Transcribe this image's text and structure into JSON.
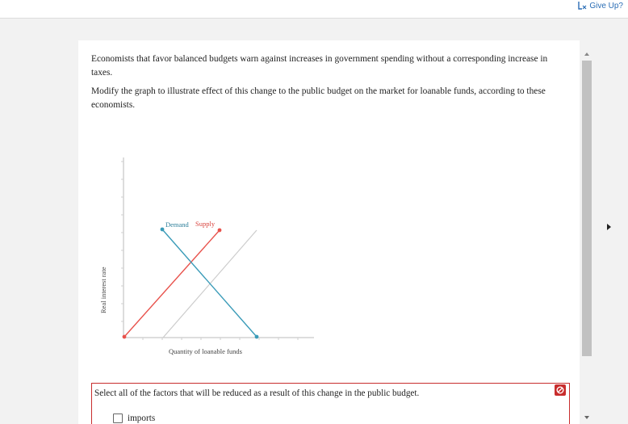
{
  "header": {
    "give_up_label": "Give Up?",
    "give_up_icon": "give-up-icon"
  },
  "question": {
    "paragraph1": "Economists that favor balanced budgets warn against increases in government spending without a corresponding increase in taxes.",
    "paragraph2": "Modify the graph to illustrate effect of this change to the public budget on the market for loanable funds, according to these economists."
  },
  "graph": {
    "y_axis_label": "Real interest rate",
    "x_axis_label": "Quantity of loanable funds",
    "demand_label": "Demand",
    "supply_label": "Supply",
    "colors": {
      "demand": "#3a9bb8",
      "supply": "#e8524c",
      "reference": "#cccccc"
    }
  },
  "answer_box": {
    "prompt": "Select all of the factors that will be reduced as a result of this change in the public budget.",
    "status_icon": "incorrect-icon",
    "options": [
      {
        "label": "imports",
        "checked": false
      }
    ]
  }
}
